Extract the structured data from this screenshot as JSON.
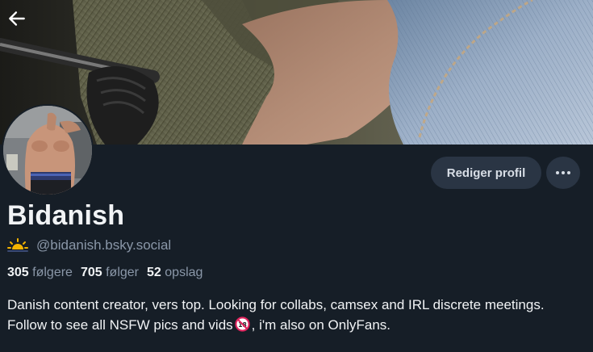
{
  "profile": {
    "display_name": "Bidanish",
    "handle": "@bidanish.bsky.social",
    "handle_badge_icon": "sunrise-icon",
    "stats": {
      "followers_count": "305",
      "followers_label": "følgere",
      "following_count": "705",
      "following_label": "følger",
      "posts_count": "52",
      "posts_label": "opslag"
    },
    "bio_part1": "Danish content creator, vers top. Looking for collabs, camsex and IRL discrete meetings. Follow to see all NSFW pics and vids",
    "bio_emoji": "no-under-18-icon",
    "bio_part2": ", i'm also on OnlyFans."
  },
  "actions": {
    "edit_profile_label": "Rediger profil",
    "more_icon": "more-horizontal-icon",
    "back_icon": "arrow-left-icon"
  },
  "colors": {
    "background": "#161e27",
    "button_bg": "#2a3544",
    "muted_text": "#8a97a8",
    "primary_text": "#f1f3f5"
  }
}
